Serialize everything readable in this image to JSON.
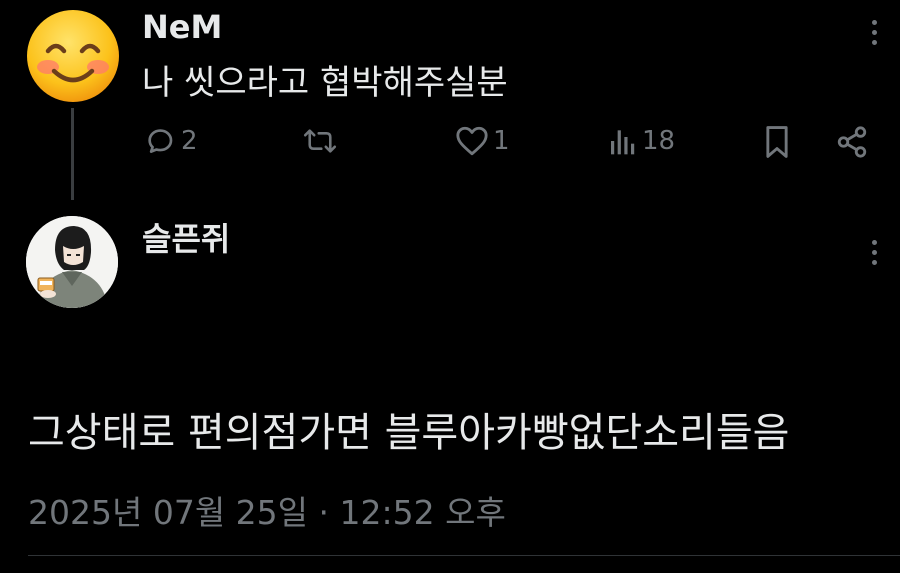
{
  "tweet": {
    "author_name": "NeM",
    "text": "나 씻으라고 협박해주실분",
    "metrics": {
      "replies": "2",
      "retweets": "",
      "likes": "1",
      "views": "18"
    }
  },
  "reply": {
    "author_name": "슬픈쥐",
    "text": "그상태로 편의점가면 블루아카빵없단소리들음",
    "timestamp": "2025년 07월 25일 · 12:52 오후"
  },
  "icons": {
    "reply": "comment-icon",
    "retweet": "retweet-icon",
    "like": "heart-icon",
    "views": "views-icon",
    "bookmark": "bookmark-icon",
    "share": "share-icon",
    "more": "more-icon"
  },
  "colors": {
    "background": "#000000",
    "text_primary": "#e7e9ea",
    "text_secondary": "#71767b"
  }
}
